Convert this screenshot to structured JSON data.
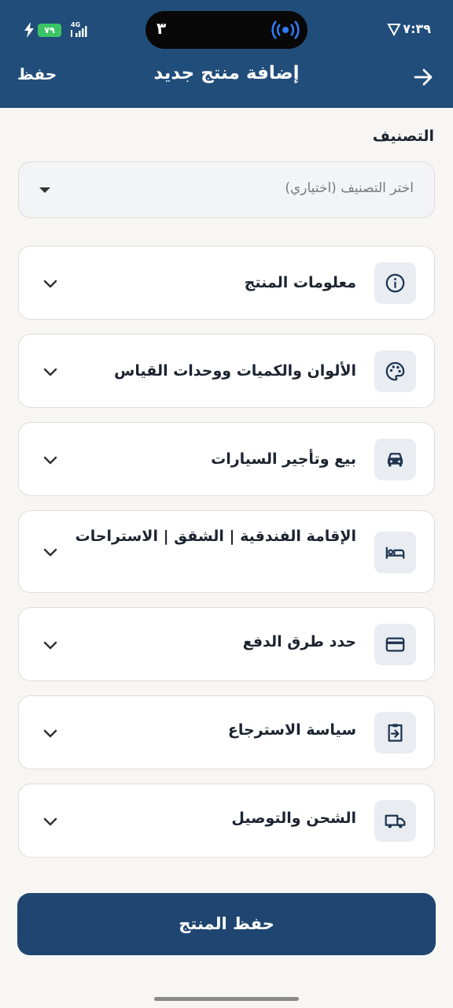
{
  "status_bar": {
    "time": "٧:٣٩",
    "battery": "٧٩",
    "network": "4G",
    "notch_number": "٣"
  },
  "header": {
    "title": "إضافة منتج جديد",
    "save_label": "حفظ"
  },
  "category": {
    "label": "التصنيف",
    "placeholder": "اختر التصنيف (اختياري)"
  },
  "sections": [
    {
      "label": "معلومات المنتج",
      "icon": "info-icon"
    },
    {
      "label": "الألوان والكميات ووحدات القياس",
      "icon": "palette-icon"
    },
    {
      "label": "بيع وتأجير السيارات",
      "icon": "car-icon"
    },
    {
      "label": "الإقامة الفندقية | الشقق | الاستراحات",
      "icon": "bed-icon"
    },
    {
      "label": "حدد طرق الدفع",
      "icon": "credit-card-icon"
    },
    {
      "label": "سياسة الاسترجاع",
      "icon": "return-icon"
    },
    {
      "label": "الشحن والتوصيل",
      "icon": "truck-icon"
    }
  ],
  "footer": {
    "save_product_label": "حفظ المنتج"
  },
  "colors": {
    "header_bg": "#214d7a",
    "button_bg": "#1f4670",
    "page_bg": "#f7f6f3"
  }
}
